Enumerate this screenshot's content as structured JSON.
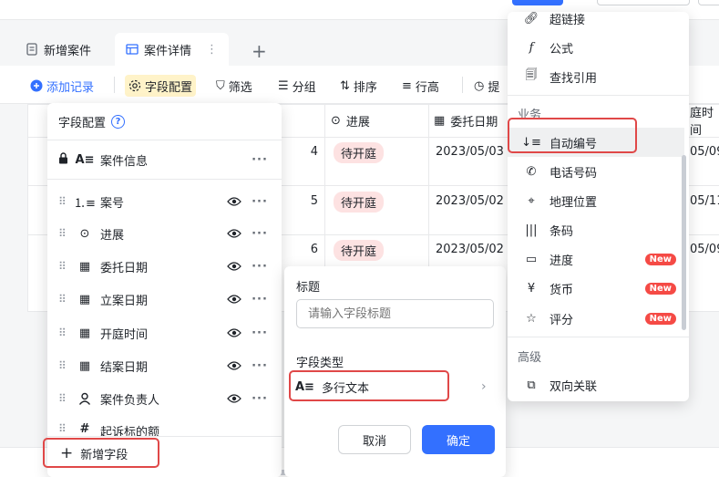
{
  "tabs": [
    {
      "label": "新增案件"
    },
    {
      "label": "案件详情"
    }
  ],
  "toolbar": {
    "add_record": "添加记录",
    "field_config": "字段配置",
    "filter": "筛选",
    "group": "分组",
    "sort": "排序",
    "row_height": "行高",
    "partial": "提"
  },
  "grid": {
    "headers": {
      "progress": "进展",
      "entrust_date": "委托日期",
      "partial_time": "庭时间"
    },
    "rows": [
      {
        "id": "4",
        "status": "待开庭",
        "entrust": "2023/05/03",
        "next": "05/09"
      },
      {
        "id": "5",
        "status": "待开庭",
        "entrust": "2023/05/02",
        "next": "05/11"
      },
      {
        "id": "6",
        "status": "待开庭",
        "entrust": "2023/05/02",
        "next": "05/09"
      }
    ]
  },
  "field_panel": {
    "title": "字段配置",
    "locked_field": "案件信息",
    "fields": [
      "案号",
      "进展",
      "委托日期",
      "立案日期",
      "开庭时间",
      "结案日期",
      "案件负责人",
      "起诉标的额"
    ],
    "add_field": "新增字段"
  },
  "new_field": {
    "title_label": "标题",
    "title_placeholder": "请输入字段标题",
    "type_label": "字段类型",
    "type_value": "多行文本",
    "cancel": "取消",
    "ok": "确定"
  },
  "type_menu": {
    "top_items": [
      "超链接",
      "公式",
      "查找引用"
    ],
    "business_section": "业务",
    "business_items": [
      {
        "label": "自动编号",
        "icon": "auto-number-icon"
      },
      {
        "label": "电话号码",
        "icon": "phone-icon"
      },
      {
        "label": "地理位置",
        "icon": "location-icon"
      },
      {
        "label": "条码",
        "icon": "barcode-icon"
      },
      {
        "label": "进度",
        "icon": "progress-icon",
        "badge": "New"
      },
      {
        "label": "货币",
        "icon": "currency-icon",
        "badge": "New"
      },
      {
        "label": "评分",
        "icon": "star-icon",
        "badge": "New"
      }
    ],
    "advanced_section": "高级",
    "advanced_items": [
      "双向关联"
    ]
  },
  "colors": {
    "accent": "#3370ff",
    "highlight_box": "#e04848",
    "new_badge": "#f54a45",
    "status_pill": "#fde2e2"
  }
}
